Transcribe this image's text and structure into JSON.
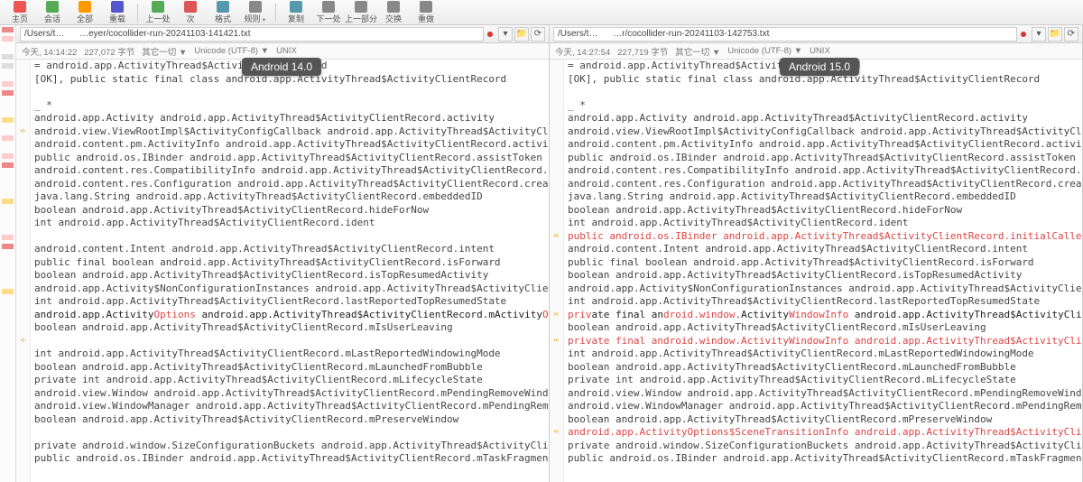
{
  "toolbar": [
    {
      "label": "主页",
      "icon": "#e55"
    },
    {
      "label": "会话",
      "icon": "#5a5"
    },
    {
      "label": "全部",
      "icon": "#f90"
    },
    {
      "label": "重载",
      "icon": "#55c"
    },
    {
      "label": "",
      "icon": ""
    },
    {
      "label": "上一处",
      "icon": "#5a5"
    },
    {
      "label": "次",
      "icon": "#d55"
    },
    {
      "label": "格式",
      "icon": "#59a"
    },
    {
      "label": "规则",
      "icon": "#888",
      "caret": true
    },
    {
      "label": "",
      "icon": ""
    },
    {
      "label": "复制",
      "icon": "#59a"
    },
    {
      "label": "下一处",
      "icon": "#888"
    },
    {
      "label": "上一部分",
      "icon": "#888"
    },
    {
      "label": "交换",
      "icon": "#888"
    },
    {
      "label": "重做",
      "icon": "#888"
    }
  ],
  "left_badge": "Android 14.0",
  "right_badge": "Android 15.0",
  "left": {
    "path": "/Users/t…      …eyer/cocollider-run-20241103-141421.txt",
    "status": [
      "今天, 14:14:22",
      "227,072 字节",
      "其它一切 ▼",
      "Unicode (UTF-8) ▼",
      "UNIX"
    ],
    "gutter": [
      "",
      "",
      "",
      "",
      "",
      "on",
      "",
      "",
      "",
      "",
      "",
      "",
      "",
      "",
      "",
      "",
      "",
      "",
      "",
      "",
      "",
      "on",
      "",
      "",
      "",
      "",
      "",
      "",
      "",
      "",
      "",
      "",
      "on"
    ],
    "lines": [
      "=  android.app.ActivityThread$ActivityClientRecord",
      "[OK], public  static  final  class  android.app.ActivityThread$ActivityClientRecord",
      "",
      "_ *",
      "android.app.Activity  android.app.ActivityThread$ActivityClientRecord.activity",
      "android.view.ViewRootImpl$ActivityConfigCallback  android.app.ActivityThread$ActivityClientRecord.activityConfigC",
      "android.content.pm.ActivityInfo  android.app.ActivityThread$ActivityClientRecord.activityInfo",
      "public  android.os.IBinder  android.app.ActivityThread$ActivityClientRecord.assistToken",
      "android.content.res.CompatibilityInfo  android.app.ActivityThread$ActivityClientRecord.compatInfo",
      "android.content.res.Configuration  android.app.ActivityThread$ActivityClientRecord.createdConfig",
      "java.lang.String  android.app.ActivityThread$ActivityClientRecord.embeddedID",
      "boolean  android.app.ActivityThread$ActivityClientRecord.hideForNow",
      "int  android.app.ActivityThread$ActivityClientRecord.ident",
      "",
      "android.content.Intent  android.app.ActivityThread$ActivityClientRecord.intent",
      "public  final  boolean  android.app.ActivityThread$ActivityClientRecord.isForward",
      "boolean  android.app.ActivityThread$ActivityClientRecord.isTopResumedActivity",
      "android.app.Activity$NonConfigurationInstances  android.app.ActivityThread$ActivityClientRecord.lastNonConfigurai",
      "int  android.app.ActivityThread$ActivityClientRecord.lastReportedTopResumedState",
      {
        "diff": true,
        "segs": [
          {
            "t": "an"
          },
          {
            "t": "droid.app.Activity",
            "r": false
          },
          {
            "t": "Options",
            "r": true
          },
          {
            "t": "  android.app.ActivityThread$ActivityClientRecord.mActivity"
          },
          {
            "t": "Options",
            "r": true
          }
        ]
      },
      "boolean  android.app.ActivityThread$ActivityClientRecord.mIsUserLeaving",
      "",
      "int  android.app.ActivityThread$ActivityClientRecord.mLastReportedWindowingMode",
      "boolean  android.app.ActivityThread$ActivityClientRecord.mLaunchedFromBubble",
      "private  int  android.app.ActivityThread$ActivityClientRecord.mLifecycleState",
      "android.view.Window  android.app.ActivityThread$ActivityClientRecord.mPendingRemoveWindow",
      "android.view.WindowManager  android.app.ActivityThread$ActivityClientRecord.mPendingRemoveWindowManager",
      "boolean  android.app.ActivityThread$ActivityClientRecord.mPreserveWindow",
      "",
      "private  android.window.SizeConfigurationBuckets  android.app.ActivityThread$ActivityClientRecord.mSizeConfigur",
      "public  android.os.IBinder  android.app.ActivityThread$ActivityClientRecord.mTaskFragmentToken"
    ]
  },
  "right": {
    "path": "/Users/t…      …r/cocollider-run-20241103-142753.txt",
    "status": [
      "今天, 14:27:54",
      "227,719 字节",
      "其它一切 ▼",
      "Unicode (UTF-8) ▼",
      "UNIX"
    ],
    "gutter": [
      "",
      "",
      "",
      "",
      "",
      "",
      "",
      "",
      "",
      "",
      "",
      "",
      "",
      "on",
      "",
      "",
      "",
      "",
      "",
      "on",
      "",
      "on",
      "",
      "",
      "",
      "",
      "",
      "",
      "on",
      "",
      "",
      ""
    ],
    "lines": [
      "=  android.app.ActivityThread$ActivityClientRecord",
      "[OK], public  static  final  class  android.app.ActivityThread$ActivityClientRecord",
      "",
      "_ *",
      "android.app.Activity  android.app.ActivityThread$ActivityClientRecord.activity",
      "android.view.ViewRootImpl$ActivityConfigCallback  android.app.ActivityThread$ActivityClientRecord.activityConfig",
      "android.content.pm.ActivityInfo  android.app.ActivityThread$ActivityClientRecord.activityInfo",
      "public  android.os.IBinder  android.app.ActivityThread$ActivityClientRecord.assistToken",
      "android.content.res.CompatibilityInfo  android.app.ActivityThread$ActivityClientRecord.compatInfo",
      "android.content.res.Configuration  android.app.ActivityThread$ActivityClientRecord.createdConfig",
      "java.lang.String  android.app.ActivityThread$ActivityClientRecord.embeddedID",
      "boolean  android.app.ActivityThread$ActivityClientRecord.hideForNow",
      "int  android.app.ActivityThread$ActivityClientRecord.ident",
      {
        "diff": true,
        "segs": [
          {
            "t": "public  android.os.IBinder  android.app.ActivityThread$ActivityClientRecord.initialCallerInfoAccessToken",
            "r": true
          }
        ]
      },
      "android.content.Intent  android.app.ActivityThread$ActivityClientRecord.intent",
      "public  final  boolean  android.app.ActivityThread$ActivityClientRecord.isForward",
      "boolean  android.app.ActivityThread$ActivityClientRecord.isTopResumedActivity",
      "android.app.Activity$NonConfigurationInstances  android.app.ActivityThread$ActivityClientRecord.lastNonConfigur",
      "int  android.app.ActivityThread$ActivityClientRecord.lastReportedTopResumedState",
      {
        "diff": true,
        "segs": [
          {
            "t": "priv",
            "r": true
          },
          {
            "t": "ate  final  an"
          },
          {
            "t": "droid.window.",
            "r": true
          },
          {
            "t": "Activity"
          },
          {
            "t": "WindowInfo",
            "r": true
          },
          {
            "t": "  android.app.ActivityThread$ActivityClientRecord.mActivity"
          },
          {
            "t": "Windo",
            "r": true
          }
        ]
      },
      "boolean  android.app.ActivityThread$ActivityClientRecord.mIsUserLeaving",
      {
        "diff": true,
        "segs": [
          {
            "t": "private  final  android.window.ActivityWindowInfo  android.app.ActivityThread$ActivityClientRecord.mLastReported.",
            "r": true
          }
        ]
      },
      "int  android.app.ActivityThread$ActivityClientRecord.mLastReportedWindowingMode",
      "boolean  android.app.ActivityThread$ActivityClientRecord.mLaunchedFromBubble",
      "private  int  android.app.ActivityThread$ActivityClientRecord.mLifecycleState",
      "android.view.Window  android.app.ActivityThread$ActivityClientRecord.mPendingRemoveWindow",
      "android.view.WindowManager  android.app.ActivityThread$ActivityClientRecord.mPendingRemoveWindowManager",
      "boolean  android.app.ActivityThread$ActivityClientRecord.mPreserveWindow",
      {
        "diff": true,
        "segs": [
          {
            "t": "android.app.ActivityOptions$SceneTransitionInfo  android.app.ActivityThread$ActivityClientRecord.mSceneTransiti",
            "r": true
          }
        ]
      },
      "private  android.window.SizeConfigurationBuckets  android.app.ActivityThread$ActivityClientRecord.mSizeConfigur",
      "public  android.os.IBinder  android.app.ActivityThread$ActivityClientRecord.mTaskFragmentToken"
    ]
  },
  "sidegutter": [
    "g-red",
    "g-pink",
    "",
    "g-grey",
    "g-grey",
    "",
    "g-pink",
    "g-red",
    "",
    "",
    "g-yell",
    "",
    "g-pink",
    "",
    "g-pink",
    "g-red",
    "",
    "",
    "",
    "g-yell",
    "",
    "",
    "",
    "g-pink",
    "g-red",
    "",
    "",
    "",
    "",
    "g-yell"
  ]
}
